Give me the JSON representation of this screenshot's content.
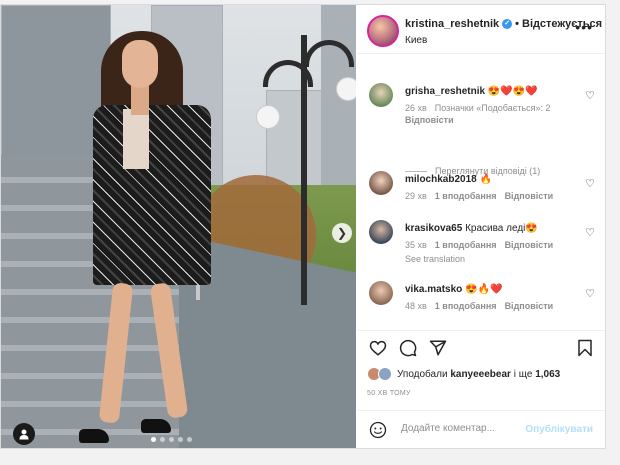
{
  "post": {
    "username": "kristina_reshetnik",
    "follow_label": "Відстежується",
    "location": "Киев",
    "more_icon": "more-horizontal-icon",
    "carousel": {
      "total": 5,
      "active": 0
    }
  },
  "comments": [
    {
      "username": "grisha_reshetnik",
      "text": "😍❤️😍❤️",
      "time": "26 хв",
      "likes_label": "Позначки «Подобається»: 2",
      "reply_label": "Відповісти",
      "view_replies_label": "Переглянути відповіді (1)"
    },
    {
      "username": "milochkab2018",
      "text": "🔥",
      "time": "29 хв",
      "likes_label": "1 вподобання",
      "reply_label": "Відповісти"
    },
    {
      "username": "krasikova65",
      "text": "Красива леді😍",
      "time": "35 хв",
      "likes_label": "1 вподобання",
      "reply_label": "Відповісти",
      "see_translation_label": "See translation"
    },
    {
      "username": "vika.matsko",
      "text": "😍🔥❤️",
      "time": "48 хв",
      "likes_label": "1 вподобання",
      "reply_label": "Відповісти"
    }
  ],
  "liked_by": {
    "prefix": "Уподобали",
    "user": "kanyeeebear",
    "middle": "і ще",
    "count": "1,063"
  },
  "posted_time": "50 ХВ ТОМУ",
  "comment_box": {
    "placeholder": "Додайте коментар...",
    "publish_label": "Опублікувати"
  },
  "colors": {
    "accent": "#3897f0",
    "publish_disabled": "#b2dffc",
    "secondary_text": "#8e8e8e"
  }
}
